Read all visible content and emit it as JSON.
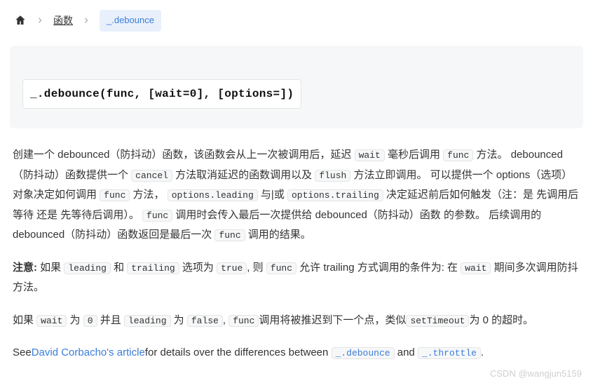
{
  "breadcrumb": {
    "item1": "函数",
    "current": "_.debounce"
  },
  "signature": "_.debounce(func, [wait=0], [options=])",
  "codes": {
    "wait": "wait",
    "func": "func",
    "cancel": "cancel",
    "flush": "flush",
    "options_leading": "options.leading",
    "options_trailing": "options.trailing",
    "leading": "leading",
    "trailing": "trailing",
    "true": "true",
    "zero": "0",
    "false_": "false",
    "setTimeout": "setTimeout",
    "debounce_link": "_.debounce",
    "throttle_link": "_.throttle"
  },
  "text": {
    "p1_a": "创建一个 debounced（防抖动）函数，该函数会从上一次被调用后，延迟 ",
    "p1_b": " 毫秒后调用 ",
    "p1_c": " 方法。 debounced（防抖动）函数提供一个 ",
    "p1_d": " 方法取消延迟的函数调用以及 ",
    "p1_e": " 方法立即调用。 可以提供一个 options（选项） 对象决定如何调用 ",
    "p1_f": " 方法， ",
    "p1_g": " 与|或 ",
    "p1_h": " 决定延迟前后如何触发（注：是 先调用后等待 还是 先等待后调用）。 ",
    "p1_i": " 调用时会传入最后一次提供给 debounced（防抖动）函数 的参数。 后续调用的 debounced（防抖动）函数返回是最后一次 ",
    "p1_j": " 调用的结果。",
    "p2_label": "注意:",
    "p2_a": " 如果 ",
    "p2_b": " 和 ",
    "p2_c": " 选项为 ",
    "p2_d": ", 则 ",
    "p2_e": " 允许 trailing 方式调用的条件为: 在 ",
    "p2_f": " 期间多次调用防抖方法。",
    "p3_a": "如果 ",
    "p3_b": " 为 ",
    "p3_c": " 并且 ",
    "p3_d": " 为 ",
    "p3_e": ", ",
    "p3_f": "调用将被推迟到下一个点，类似",
    "p3_g": "为 0 的超时。",
    "p4_a": "See",
    "p4_link": "David Corbacho's article",
    "p4_b": "for details over the differences between",
    "p4_c": "and",
    "p4_d": "."
  },
  "watermark": "CSDN @wangjun5159"
}
